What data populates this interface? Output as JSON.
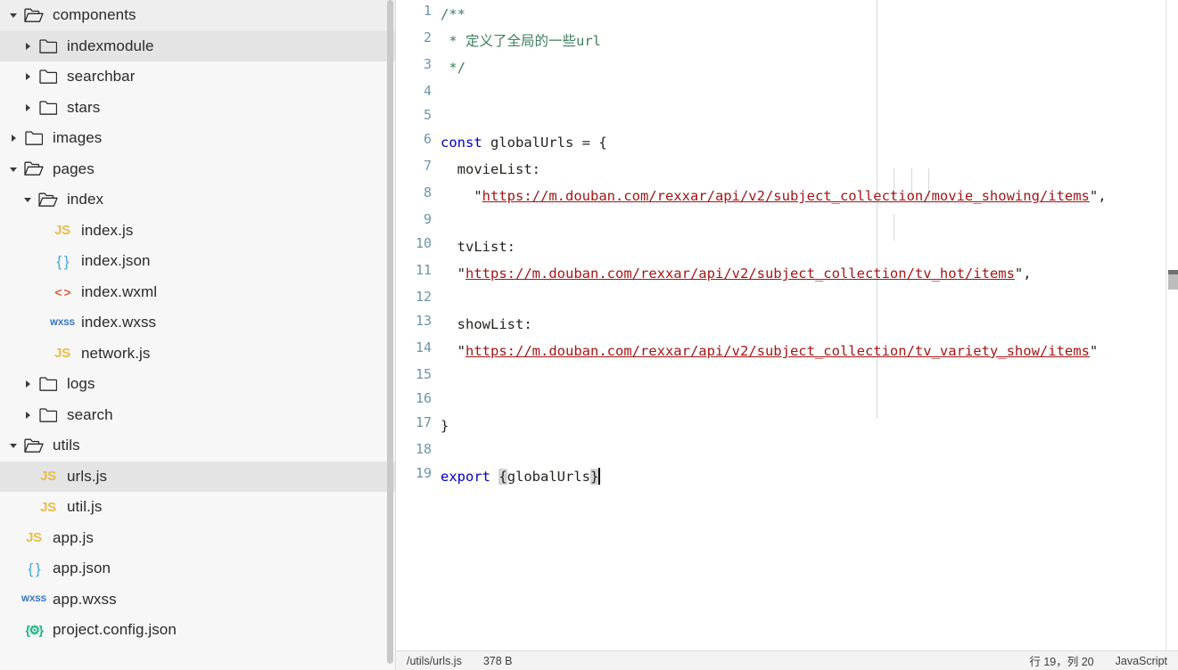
{
  "sidebar": {
    "tree": [
      {
        "label": "components",
        "type": "folder-open",
        "indent": 0,
        "twisty": "down",
        "selected": false
      },
      {
        "label": "indexmodule",
        "type": "folder",
        "indent": 1,
        "twisty": "right",
        "selected": true
      },
      {
        "label": "searchbar",
        "type": "folder",
        "indent": 1,
        "twisty": "right",
        "selected": false
      },
      {
        "label": "stars",
        "type": "folder",
        "indent": 1,
        "twisty": "right",
        "selected": false
      },
      {
        "label": "images",
        "type": "folder",
        "indent": 0,
        "twisty": "right",
        "selected": false
      },
      {
        "label": "pages",
        "type": "folder-open",
        "indent": 0,
        "twisty": "down",
        "selected": false
      },
      {
        "label": "index",
        "type": "folder-open",
        "indent": 1,
        "twisty": "down",
        "selected": false
      },
      {
        "label": "index.js",
        "type": "js",
        "indent": 2,
        "twisty": "none",
        "selected": false
      },
      {
        "label": "index.json",
        "type": "json",
        "indent": 2,
        "twisty": "none",
        "selected": false
      },
      {
        "label": "index.wxml",
        "type": "wxml",
        "indent": 2,
        "twisty": "none",
        "selected": false
      },
      {
        "label": "index.wxss",
        "type": "wxss",
        "indent": 2,
        "twisty": "none",
        "selected": false
      },
      {
        "label": "network.js",
        "type": "js",
        "indent": 2,
        "twisty": "none",
        "selected": false
      },
      {
        "label": "logs",
        "type": "folder",
        "indent": 1,
        "twisty": "right",
        "selected": false
      },
      {
        "label": "search",
        "type": "folder",
        "indent": 1,
        "twisty": "right",
        "selected": false
      },
      {
        "label": "utils",
        "type": "folder-open",
        "indent": 0,
        "twisty": "down",
        "selected": false
      },
      {
        "label": "urls.js",
        "type": "js",
        "indent": 1,
        "twisty": "none",
        "selected": true
      },
      {
        "label": "util.js",
        "type": "js",
        "indent": 1,
        "twisty": "none",
        "selected": false
      },
      {
        "label": "app.js",
        "type": "js",
        "indent": 0,
        "twisty": "none",
        "selected": false
      },
      {
        "label": "app.json",
        "type": "json",
        "indent": 0,
        "twisty": "none",
        "selected": false
      },
      {
        "label": "app.wxss",
        "type": "wxss",
        "indent": 0,
        "twisty": "none",
        "selected": false
      },
      {
        "label": "project.config.json",
        "type": "config",
        "indent": 0,
        "twisty": "none",
        "selected": false
      }
    ],
    "icon_text": {
      "js": "JS",
      "json": "{ }",
      "wxml": "< >",
      "wxss": "WXSS",
      "config": "{⚙}"
    }
  },
  "editor": {
    "lines": [
      {
        "no": "1",
        "segments": [
          {
            "t": "comment",
            "v": "/**"
          }
        ]
      },
      {
        "no": "2",
        "segments": [
          {
            "t": "comment",
            "v": " * 定义了全局的一些url"
          }
        ]
      },
      {
        "no": "3",
        "segments": [
          {
            "t": "comment",
            "v": " */"
          }
        ]
      },
      {
        "no": "4",
        "segments": [
          {
            "t": "plain",
            "v": ""
          }
        ]
      },
      {
        "no": "5",
        "segments": [
          {
            "t": "plain",
            "v": ""
          }
        ]
      },
      {
        "no": "6",
        "segments": [
          {
            "t": "kw",
            "v": "const"
          },
          {
            "t": "plain",
            "v": " globalUrls = {"
          }
        ]
      },
      {
        "no": "7",
        "segments": [
          {
            "t": "plain",
            "v": "  movieList:"
          }
        ]
      },
      {
        "no": "8",
        "segments": [
          {
            "t": "punct",
            "v": "    \""
          },
          {
            "t": "str",
            "v": "https://m.douban.com/rexxar/api/v2/subject_collection/movie_showing/items"
          },
          {
            "t": "punct",
            "v": "\","
          }
        ]
      },
      {
        "no": "9",
        "segments": [
          {
            "t": "plain",
            "v": ""
          }
        ]
      },
      {
        "no": "10",
        "segments": [
          {
            "t": "plain",
            "v": "  tvList:"
          }
        ]
      },
      {
        "no": "11",
        "segments": [
          {
            "t": "punct",
            "v": "  \""
          },
          {
            "t": "str",
            "v": "https://m.douban.com/rexxar/api/v2/subject_collection/tv_hot/items"
          },
          {
            "t": "punct",
            "v": "\","
          }
        ]
      },
      {
        "no": "12",
        "segments": [
          {
            "t": "plain",
            "v": ""
          }
        ]
      },
      {
        "no": "13",
        "segments": [
          {
            "t": "plain",
            "v": "  showList:"
          }
        ]
      },
      {
        "no": "14",
        "segments": [
          {
            "t": "punct",
            "v": "  \""
          },
          {
            "t": "str",
            "v": "https://m.douban.com/rexxar/api/v2/subject_collection/tv_variety_show/items"
          },
          {
            "t": "punct",
            "v": "\""
          }
        ]
      },
      {
        "no": "15",
        "segments": [
          {
            "t": "plain",
            "v": ""
          }
        ]
      },
      {
        "no": "16",
        "segments": [
          {
            "t": "plain",
            "v": ""
          }
        ]
      },
      {
        "no": "17",
        "segments": [
          {
            "t": "plain",
            "v": "}"
          }
        ]
      },
      {
        "no": "18",
        "segments": [
          {
            "t": "plain",
            "v": ""
          }
        ]
      },
      {
        "no": "19",
        "segments": [
          {
            "t": "kw",
            "v": "export"
          },
          {
            "t": "plain",
            "v": " "
          },
          {
            "t": "bracket",
            "v": "{"
          },
          {
            "t": "plain",
            "v": "globalUrls"
          },
          {
            "t": "bracket",
            "v": "}"
          },
          {
            "t": "caret",
            "v": ""
          }
        ]
      }
    ]
  },
  "statusbar": {
    "file_path": "/utils/urls.js",
    "file_size": "378 B",
    "cursor_position": "行 19，列 20",
    "language": "JavaScript"
  },
  "colors": {
    "sidebar_bg": "#f7f7f7",
    "selected_row": "#e4e4e4",
    "keyword": "#0000c0",
    "comment": "#3f7f5f",
    "string": "#a31515",
    "gutter": "#6d96a8",
    "statusbar_bg": "#f3f3f3"
  }
}
